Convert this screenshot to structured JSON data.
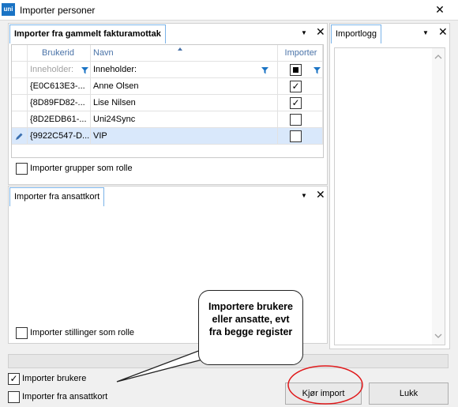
{
  "window": {
    "title": "Importer personer",
    "logo_text": "uni",
    "close_glyph": "✕"
  },
  "panel_invoice": {
    "tab": "Importer fra gammelt fakturamottak",
    "pin_glyph": "▼",
    "close_glyph": "✕",
    "columns": {
      "id": "Brukerid",
      "name": "Navn",
      "import": "Importer"
    },
    "filter": {
      "id": "Inneholder:",
      "name": "Inneholder:"
    },
    "rows": [
      {
        "id": "{E0C613E3-...",
        "name": "Anne Olsen",
        "checked": "✓"
      },
      {
        "id": "{8D89FD82-...",
        "name": "Lise Nilsen",
        "checked": "✓"
      },
      {
        "id": "{8D2EDB61-...",
        "name": "Uni24Sync",
        "checked": ""
      },
      {
        "id": "{9922C547-D...",
        "name": "VIP",
        "checked": ""
      }
    ],
    "option_groups": "Importer grupper som rolle"
  },
  "panel_employee": {
    "tab": "Importer fra ansattkort",
    "pin_glyph": "▼",
    "close_glyph": "✕",
    "option_positions": "Importer stillinger som rolle"
  },
  "panel_log": {
    "tab": "Importlogg",
    "pin_glyph": "▼",
    "close_glyph": "✕"
  },
  "footer": {
    "import_users": "Importer brukere",
    "import_users_checked": "✓",
    "import_employees": "Importer fra ansattkort",
    "run_button": "Kjør import",
    "close_button": "Lukk"
  },
  "callout": {
    "line1": "Importere brukere",
    "line2": "eller ansatte, evt",
    "line3": "fra begge register"
  },
  "colors": {
    "accent": "#1a73c4",
    "selected_row": "#d9e8fb",
    "annotation_red": "#e0191b"
  }
}
